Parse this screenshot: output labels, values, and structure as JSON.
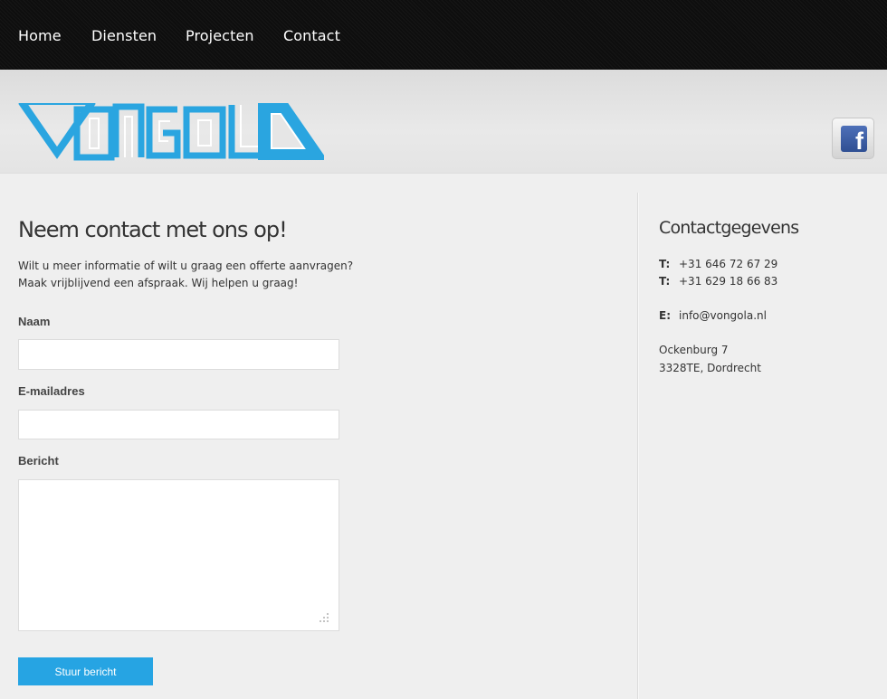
{
  "nav": {
    "items": [
      {
        "label": "Home"
      },
      {
        "label": "Diensten"
      },
      {
        "label": "Projecten"
      },
      {
        "label": "Contact"
      }
    ]
  },
  "header": {
    "logo_text": "VONGOLA",
    "social_icon": "facebook-icon",
    "facebook_glyph": "f"
  },
  "contact_form": {
    "title": "Neem contact met ons op!",
    "intro_line1": "Wilt u meer informatie of wilt u graag een offerte aanvragen?",
    "intro_line2": "Maak vrijblijvend een afspraak. Wij helpen u graag!",
    "name_label": "Naam",
    "name_value": "",
    "email_label": "E-mailadres",
    "email_value": "",
    "message_label": "Bericht",
    "message_value": "",
    "submit_label": "Stuur bericht"
  },
  "sidebar": {
    "title": "Contactgegevens",
    "phone_prefix": "T:",
    "phone1": "+31 646 72 67 29",
    "phone2": "+31 629 18 66 83",
    "email_prefix": "E:",
    "email": "info@vongola.nl",
    "address_line1": "Ockenburg 7",
    "address_line2": "3328TE, Dordrecht"
  },
  "colors": {
    "accent": "#26a4e3",
    "nav_bg": "#0e0e0e",
    "page_bg": "#efefef"
  }
}
